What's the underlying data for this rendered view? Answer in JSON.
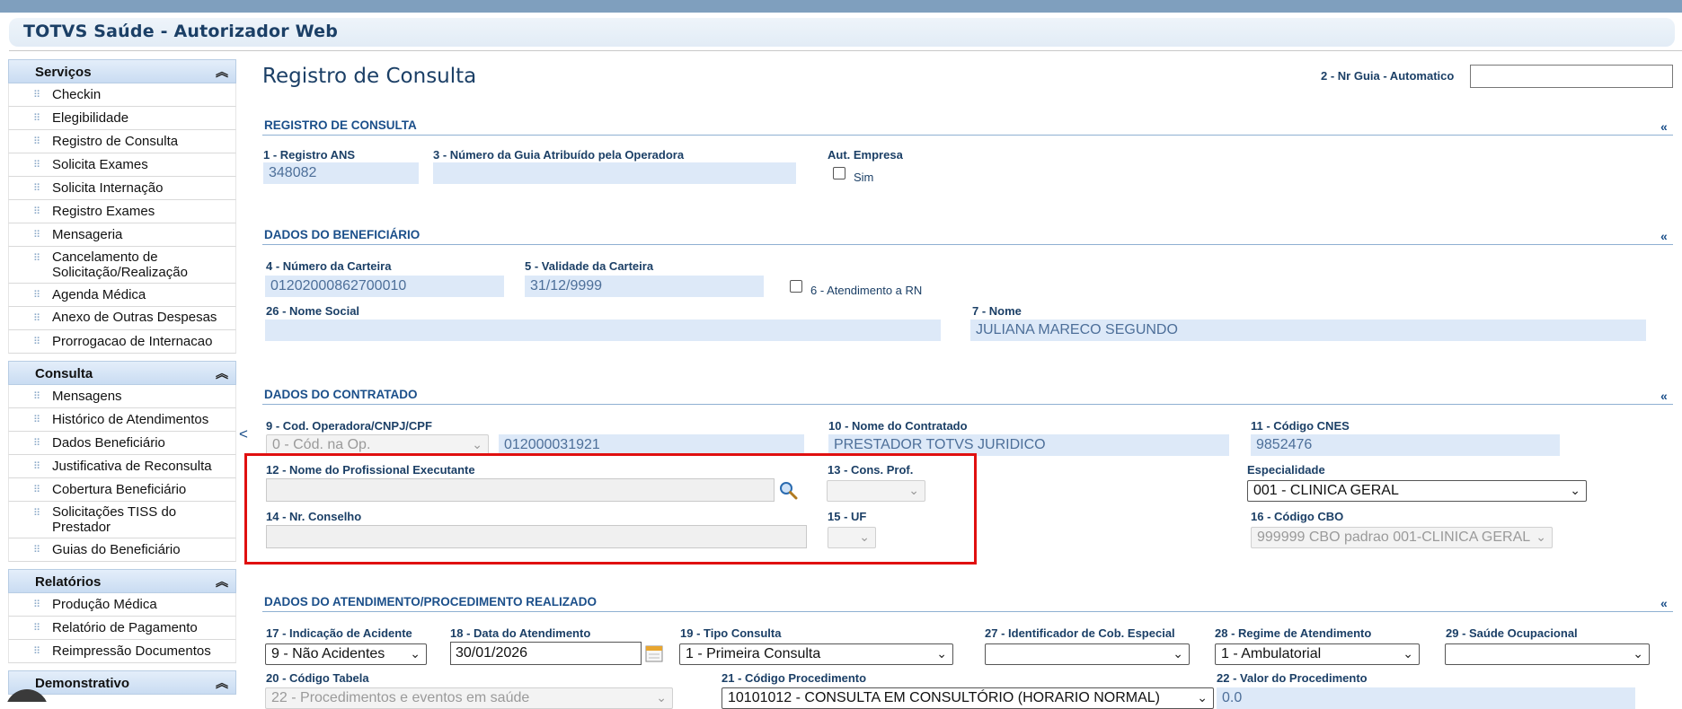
{
  "app": {
    "title": "TOTVS Saúde - Autorizador Web"
  },
  "sidebar": {
    "sections": [
      {
        "title": "Serviços",
        "items": [
          "Checkin",
          "Elegibilidade",
          "Registro de Consulta",
          "Solicita Exames",
          "Solicita Internação",
          "Registro Exames",
          "Mensageria",
          "Cancelamento de Solicitação/Realização",
          "Agenda Médica",
          "Anexo de Outras Despesas",
          "Prorrogacao de Internacao"
        ]
      },
      {
        "title": "Consulta",
        "items": [
          "Mensagens",
          "Histórico de Atendimentos",
          "Dados Beneficiário",
          "Justificativa de Reconsulta",
          "Cobertura Beneficiário",
          "Solicitações TISS do Prestador",
          "Guias do Beneficiário"
        ]
      },
      {
        "title": "Relatórios",
        "items": [
          "Produção Médica",
          "Relatório de Pagamento",
          "Reimpressão Documentos"
        ]
      },
      {
        "title": "Demonstrativo",
        "items": []
      }
    ],
    "collapse_glyph": "<"
  },
  "page": {
    "title": "Registro de Consulta",
    "guia_label": "2 - Nr Guia - Automatico",
    "guia_value": ""
  },
  "sections": {
    "registro": {
      "title": "REGISTRO DE CONSULTA",
      "registro_ans_label": "1 - Registro ANS",
      "registro_ans_value": "348082",
      "numero_guia_label": "3 - Número da Guia Atribuído pela Operadora",
      "numero_guia_value": "",
      "aut_empresa_label": "Aut. Empresa",
      "sim_label": "Sim"
    },
    "beneficiario": {
      "title": "DADOS DO BENEFICIÁRIO",
      "carteira_label": "4 - Número da Carteira",
      "carteira_value": "01202000862700010",
      "validade_label": "5 - Validade da Carteira",
      "validade_value": "31/12/9999",
      "atendimento_rn_label": "6 - Atendimento a RN",
      "nome_social_label": "26 - Nome Social",
      "nome_social_value": "",
      "nome_label": "7 - Nome",
      "nome_value": "JULIANA MARECO SEGUNDO"
    },
    "contratado": {
      "title": "DADOS DO CONTRATADO",
      "cod_operadora_label": "9 - Cod. Operadora/CNPJ/CPF",
      "cod_operadora_select": "0 - Cód. na Op.",
      "cod_operadora_value": "012000031921",
      "nome_contratado_label": "10 - Nome do Contratado",
      "nome_contratado_value": "PRESTADOR TOTVS JURIDICO",
      "cnes_label": "11 - Código CNES",
      "cnes_value": "9852476",
      "profissional_label": "12 - Nome do Profissional Executante",
      "profissional_value": "",
      "cons_prof_label": "13 - Cons. Prof.",
      "cons_prof_value": "",
      "especialidade_label": "Especialidade",
      "especialidade_value": "001 - CLINICA GERAL",
      "nr_conselho_label": "14 - Nr. Conselho",
      "nr_conselho_value": "",
      "uf_label": "15 - UF",
      "uf_value": "",
      "cbo_label": "16 - Código CBO",
      "cbo_value": "999999 CBO padrao 001-CLINICA GERAL"
    },
    "atendimento": {
      "title": "DADOS DO ATENDIMENTO/PROCEDIMENTO REALIZADO",
      "acidente_label": "17 - Indicação de Acidente",
      "acidente_value": "9 - Não Acidentes",
      "data_label": "18 - Data do Atendimento",
      "data_value": "30/01/2026",
      "tipo_label": "19 - Tipo Consulta",
      "tipo_value": "1 - Primeira Consulta",
      "cob_especial_label": "27 - Identificador de Cob. Especial",
      "cob_especial_value": "",
      "regime_label": "28 - Regime de Atendimento",
      "regime_value": "1 - Ambulatorial",
      "saude_ocup_label": "29 - Saúde Ocupacional",
      "saude_ocup_value": "",
      "tabela_label": "20 - Código Tabela",
      "tabela_value": "22 - Procedimentos e eventos em saúde",
      "procedimento_label": "21 - Código Procedimento",
      "procedimento_value": "10101012 - CONSULTA EM CONSULTÓRIO (HORARIO NORMAL)",
      "valor_label": "22 - Valor do Procedimento",
      "valor_value": "0.0"
    }
  },
  "glyphs": {
    "section_collapse": "«",
    "menu_collapse": "⌃⌃",
    "chevron": "⌄"
  },
  "colors": {
    "accent": "#1b3f66",
    "field_bg": "#dde9f8",
    "highlight": "#e01010"
  }
}
